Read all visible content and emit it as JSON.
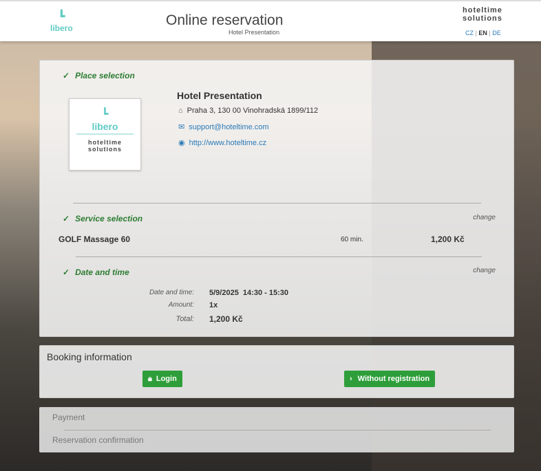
{
  "header": {
    "logo": "libero",
    "title": "Online reservation",
    "subtitle": "Hotel Presentation",
    "brand_line1": "hoteltime",
    "brand_line2": "solutions",
    "langs": [
      "CZ",
      "EN",
      "DE"
    ],
    "active_lang": "EN"
  },
  "place": {
    "step": "Place selection",
    "hotel_name": "Hotel Presentation",
    "address": "Praha 3, 130 00 Vinohradská 1899/112",
    "email": "support@hoteltime.com",
    "web": "http://www.hoteltime.cz",
    "logo_top": "libero",
    "logo_bottom1": "hoteltime",
    "logo_bottom2": "solutions"
  },
  "service": {
    "step": "Service selection",
    "change": "change",
    "name": "GOLF Massage 60",
    "duration": "60 min.",
    "price": "1,200 Kč"
  },
  "datetime": {
    "step": "Date and time",
    "change": "change",
    "rows": [
      {
        "label": "Date and time:",
        "value": "5/9/2025  14:30 - 15:30"
      },
      {
        "label": "Amount:",
        "value": "1x"
      },
      {
        "label": "Total:",
        "value": "1,200 Kč"
      }
    ]
  },
  "booking": {
    "title": "Booking information",
    "login": "Login",
    "without": "Without registration"
  },
  "steps": {
    "payment": "Payment",
    "confirmation": "Reservation confirmation"
  },
  "colors": {
    "accent": "#2e9e3a",
    "step": "#2e7d32",
    "link": "#2a7ab8",
    "libero": "#5fcbc4"
  }
}
